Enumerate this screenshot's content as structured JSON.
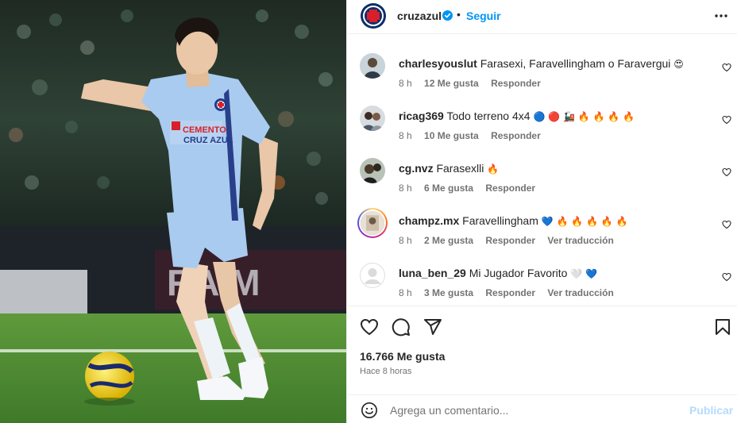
{
  "header": {
    "username": "cruzazul",
    "separator": "•",
    "follow_label": "Seguir"
  },
  "comments": [
    {
      "user": "charlesyouslut",
      "text": "Farasexi, Faravellingham o Faravergui",
      "emoji": "😍",
      "time": "8 h",
      "likes": "12 Me gusta",
      "reply": "Responder",
      "translate": ""
    },
    {
      "user": "ricag369",
      "text": "Todo terreno 4x4",
      "emoji": "🔵 🔴 🚂 🔥 🔥 🔥 🔥",
      "time": "8 h",
      "likes": "10 Me gusta",
      "reply": "Responder",
      "translate": ""
    },
    {
      "user": "cg.nvz",
      "text": "Farasexlli",
      "emoji": "🔥",
      "time": "8 h",
      "likes": "6 Me gusta",
      "reply": "Responder",
      "translate": ""
    },
    {
      "user": "champz.mx",
      "text": "Faravellingham",
      "emoji": "💙 🔥 🔥 🔥 🔥 🔥",
      "time": "8 h",
      "likes": "2 Me gusta",
      "reply": "Responder",
      "translate": "Ver traducción"
    },
    {
      "user": "luna_ben_29",
      "text": "Mi Jugador Favorito",
      "emoji": "🤍 💙",
      "time": "8 h",
      "likes": "3 Me gusta",
      "reply": "Responder",
      "translate": "Ver traducción"
    }
  ],
  "post": {
    "likes": "16.766 Me gusta",
    "time": "Hace 8 horas"
  },
  "add_comment": {
    "placeholder": "Agrega un comentario...",
    "publish_label": "Publicar"
  },
  "photo": {
    "shirt_sponsor_line1": "CEMENTO",
    "shirt_sponsor_line2": "CRUZ AZUL",
    "board_text": "RAIM"
  },
  "colors": {
    "link": "#0095f6",
    "publish_disabled": "#b3dbff",
    "muted": "#737373",
    "club_blue": "#0b2f6b",
    "club_red": "#d81f2a",
    "jersey": "#a9cbef"
  }
}
